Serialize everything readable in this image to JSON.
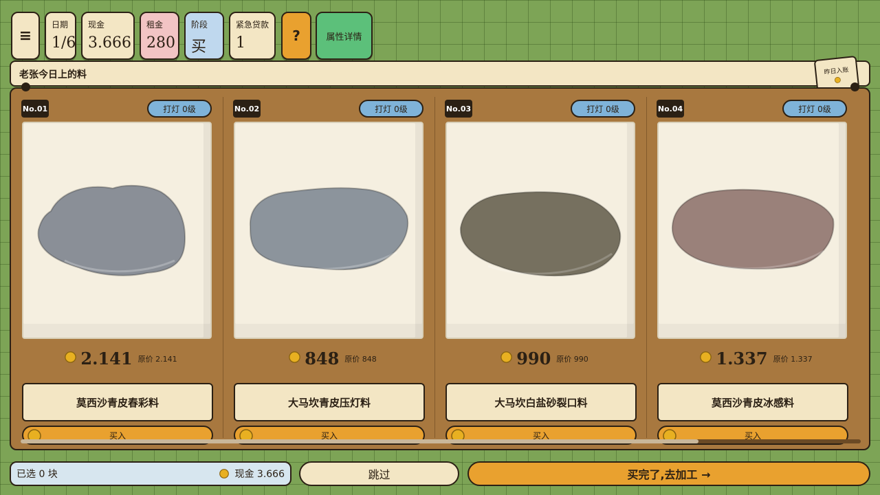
{
  "hud": {
    "menu_icon": "≡",
    "date": {
      "label": "日期",
      "value": "1/6"
    },
    "cash": {
      "label": "现金",
      "value": "3.666"
    },
    "rent": {
      "label": "租金",
      "value": "280"
    },
    "stage": {
      "label": "阶段",
      "value": "买石"
    },
    "loan": {
      "label": "紧急贷款",
      "value": "1"
    },
    "help": "?",
    "attr_button": "属性详情"
  },
  "banner": {
    "title": "老张今日上的料"
  },
  "ledger": {
    "label": "昨日入账"
  },
  "cards": [
    {
      "no": "No.01",
      "light": "打灯 0级",
      "price": "2.141",
      "original": "原价 2.141",
      "name": "莫西沙青皮春彩料",
      "buy": "买入",
      "stone_color": "#8a8f97"
    },
    {
      "no": "No.02",
      "light": "打灯 0级",
      "price": "848",
      "original": "原价 848",
      "name": "大马坎青皮压灯料",
      "buy": "买入",
      "stone_color": "#8c949c"
    },
    {
      "no": "No.03",
      "light": "打灯 0级",
      "price": "990",
      "original": "原价 990",
      "name": "大马坎白盐砂裂口料",
      "buy": "买入",
      "stone_color": "#76705f"
    },
    {
      "no": "No.04",
      "light": "打灯 0级",
      "price": "1.337",
      "original": "原价 1.337",
      "name": "莫西沙青皮冰感料",
      "buy": "买入",
      "stone_color": "#9a817a"
    }
  ],
  "bottom": {
    "selected": "已选 0 块",
    "cash": "现金 3.666",
    "skip": "跳过",
    "proceed": "买完了,去加工 →"
  },
  "colors": {
    "coin": "#e8b021",
    "accent": "#e9a12f",
    "board": "#a8783f",
    "grass": "#7da456"
  }
}
